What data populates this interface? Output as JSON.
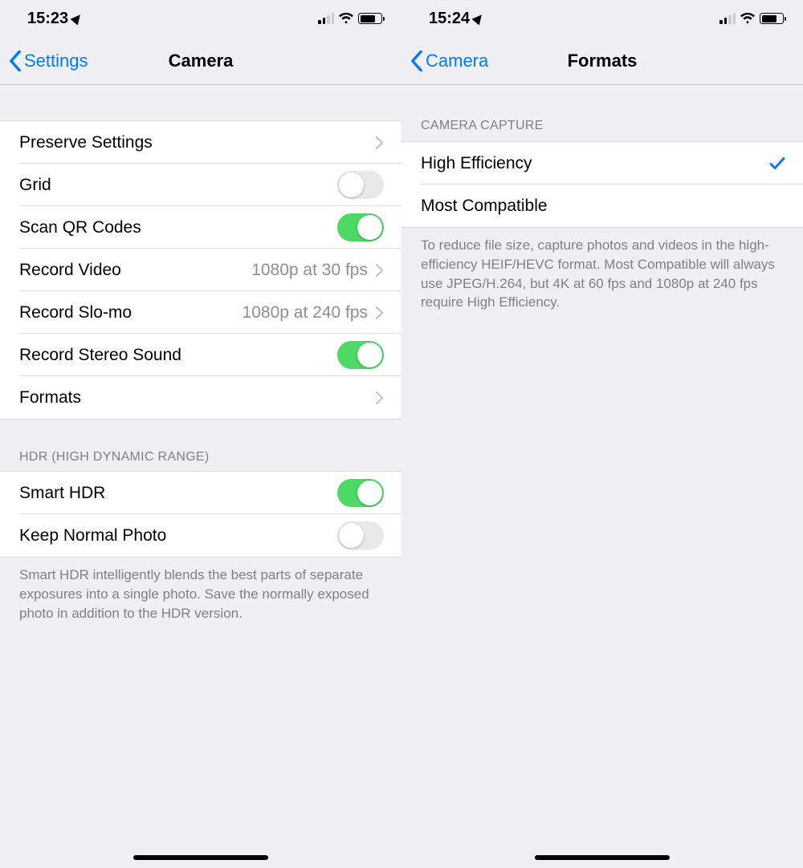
{
  "phoneLeft": {
    "status": {
      "time": "15:23"
    },
    "nav": {
      "back": "Settings",
      "title": "Camera"
    },
    "group1": {
      "rows": [
        {
          "label": "Preserve Settings",
          "type": "disclosure"
        },
        {
          "label": "Grid",
          "type": "toggle",
          "on": false
        },
        {
          "label": "Scan QR Codes",
          "type": "toggle",
          "on": true
        },
        {
          "label": "Record Video",
          "type": "detail",
          "value": "1080p at 30 fps"
        },
        {
          "label": "Record Slo-mo",
          "type": "detail",
          "value": "1080p at 240 fps"
        },
        {
          "label": "Record Stereo Sound",
          "type": "toggle",
          "on": true
        },
        {
          "label": "Formats",
          "type": "disclosure"
        }
      ]
    },
    "group2": {
      "header": "HDR (HIGH DYNAMIC RANGE)",
      "rows": [
        {
          "label": "Smart HDR",
          "type": "toggle",
          "on": true
        },
        {
          "label": "Keep Normal Photo",
          "type": "toggle",
          "on": false
        }
      ],
      "footer": "Smart HDR intelligently blends the best parts of separate exposures into a single photo. Save the normally exposed photo in addition to the HDR version."
    }
  },
  "phoneRight": {
    "status": {
      "time": "15:24"
    },
    "nav": {
      "back": "Camera",
      "title": "Formats"
    },
    "group1": {
      "header": "CAMERA CAPTURE",
      "rows": [
        {
          "label": "High Efficiency",
          "selected": true
        },
        {
          "label": "Most Compatible",
          "selected": false
        }
      ],
      "footer": "To reduce file size, capture photos and videos in the high-efficiency HEIF/HEVC format. Most Compatible will always use JPEG/H.264, but 4K at 60 fps and 1080p at 240 fps require High Efficiency."
    }
  }
}
